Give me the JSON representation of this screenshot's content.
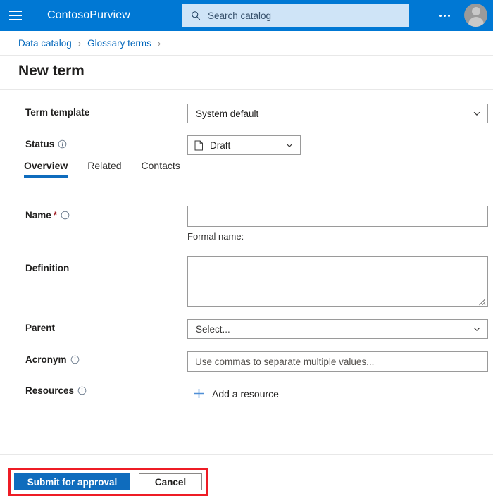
{
  "header": {
    "menu_icon": "hamburger-icon",
    "brand": "ContosoPurview",
    "search": {
      "icon": "search-icon",
      "placeholder": "Search catalog",
      "value": ""
    },
    "more_icon": "ellipsis-icon",
    "account_icon": "avatar-icon",
    "background_color": "#0078d4",
    "search_background_color": "#cfe4f7"
  },
  "breadcrumb": {
    "items": [
      {
        "label": "Data catalog"
      },
      {
        "label": "Glossary terms"
      }
    ],
    "separator": "›",
    "link_color": "#0066bb"
  },
  "page": {
    "title": "New term"
  },
  "form": {
    "term_template": {
      "label": "Term template",
      "value": "System default",
      "chevron_icon": "chevron-down-icon"
    },
    "status": {
      "label": "Status",
      "info_icon": "info-icon",
      "value": "Draft",
      "value_icon": "document-icon",
      "chevron_icon": "chevron-down-icon"
    },
    "name": {
      "label": "Name",
      "required_mark": "*",
      "info_icon": "info-icon",
      "value": "",
      "placeholder": "",
      "helper": "Formal name:"
    },
    "definition": {
      "label": "Definition",
      "value": "",
      "placeholder": "",
      "resize_grip_icon": "resize-grip-icon"
    },
    "parent": {
      "label": "Parent",
      "value": "Select...",
      "chevron_icon": "chevron-down-icon"
    },
    "acronym": {
      "label": "Acronym",
      "info_icon": "info-icon",
      "value": "",
      "placeholder": "Use commas to separate multiple values..."
    },
    "resources": {
      "label": "Resources",
      "info_icon": "info-icon",
      "add_label": "Add a resource",
      "add_icon": "plus-icon",
      "add_icon_color": "#0f6cbd"
    }
  },
  "tabs": {
    "items": [
      {
        "label": "Overview",
        "active": true
      },
      {
        "label": "Related",
        "active": false
      },
      {
        "label": "Contacts",
        "active": false
      }
    ],
    "active_indicator_color": "#0f6cbd"
  },
  "footer": {
    "submit_label": "Submit for approval",
    "cancel_label": "Cancel",
    "primary_color": "#0f6cbd",
    "annotation_color": "#ee1c25"
  }
}
